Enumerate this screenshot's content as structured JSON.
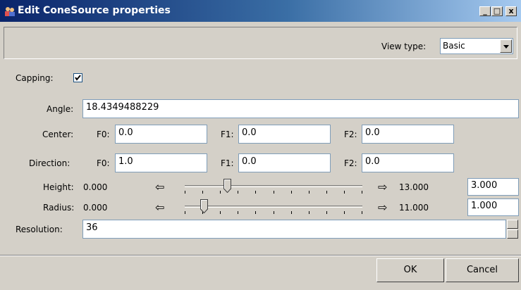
{
  "window": {
    "title": "Edit ConeSource properties",
    "controls": {
      "minimize": "_",
      "maximize": "□",
      "close": "x"
    }
  },
  "toolbar": {
    "view_type_label": "View type:",
    "view_type_value": "Basic"
  },
  "capping": {
    "label": "Capping:",
    "checked": true
  },
  "angle": {
    "label": "Angle:",
    "value": "18.4349488229"
  },
  "center": {
    "label": "Center:",
    "f0_label": "F0:",
    "f0": "0.0",
    "f1_label": "F1:",
    "f1": "0.0",
    "f2_label": "F2:",
    "f2": "0.0"
  },
  "direction": {
    "label": "Direction:",
    "f0_label": "F0:",
    "f0": "1.0",
    "f1_label": "F1:",
    "f1": "0.0",
    "f2_label": "F2:",
    "f2": "0.0"
  },
  "height": {
    "label": "Height:",
    "min": "0.000",
    "max": "13.000",
    "value": "3.000",
    "position": 0.23
  },
  "radius": {
    "label": "Radius:",
    "min": "0.000",
    "max": "11.000",
    "value": "1.000",
    "position": 0.09
  },
  "resolution": {
    "label": "Resolution:",
    "value": "36"
  },
  "buttons": {
    "ok": "OK",
    "cancel": "Cancel"
  }
}
